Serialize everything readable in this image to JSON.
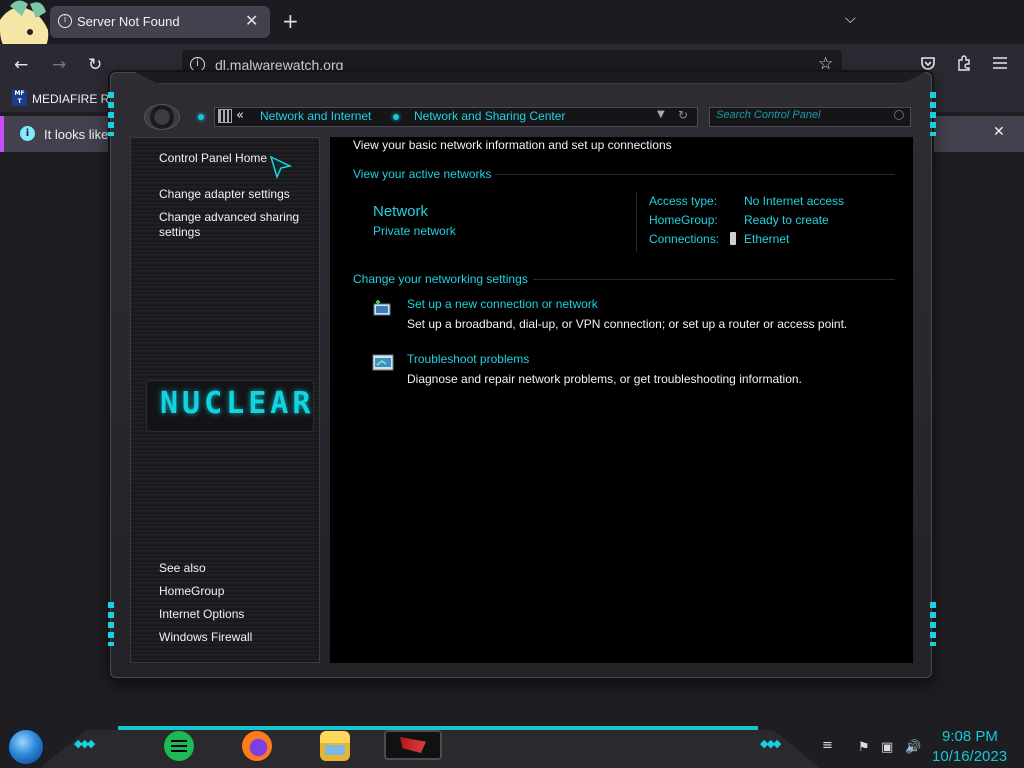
{
  "browser": {
    "tab_title": "Server Not Found",
    "tab_close": "✕",
    "new_tab": "+",
    "url": "dl.malwarewatch.org",
    "bookmark_label": "MEDIAFIRE RO",
    "bookmark_icon_text": "MF T",
    "notification_text": "It looks like y",
    "notification_close": "✕"
  },
  "control_panel": {
    "breadcrumb": [
      "Network and Internet",
      "Network and Sharing Center"
    ],
    "breadcrumb_prefix": "«",
    "search_placeholder": "Search Control Panel",
    "sidebar": {
      "home": "Control Panel Home",
      "links": [
        "Change adapter settings",
        "Change advanced sharing settings"
      ],
      "see_also_heading": "See also",
      "see_also": [
        "HomeGroup",
        "Internet Options",
        "Windows Firewall"
      ],
      "logo_text": "NUCLEAR"
    },
    "main": {
      "heading": "View your basic network information and set up connections",
      "active_networks_label": "View your active networks",
      "network_name": "Network",
      "network_type": "Private network",
      "info": [
        {
          "label": "Access type:",
          "value": "No Internet access"
        },
        {
          "label": "HomeGroup:",
          "value": "Ready to create"
        },
        {
          "label": "Connections:",
          "value": "Ethernet"
        }
      ],
      "change_settings_label": "Change your networking settings",
      "tasks": [
        {
          "title": "Set up a new connection or network",
          "desc": "Set up a broadband, dial-up, or VPN connection; or set up a router or access point."
        },
        {
          "title": "Troubleshoot problems",
          "desc": "Diagnose and repair network problems, or get troubleshooting information."
        }
      ]
    }
  },
  "taskbar": {
    "time": "9:08 PM",
    "date": "10/16/2023"
  },
  "colors": {
    "accent": "#1ed3df",
    "browser_bg": "#1c1b22",
    "notif_border": "#c74cff"
  }
}
